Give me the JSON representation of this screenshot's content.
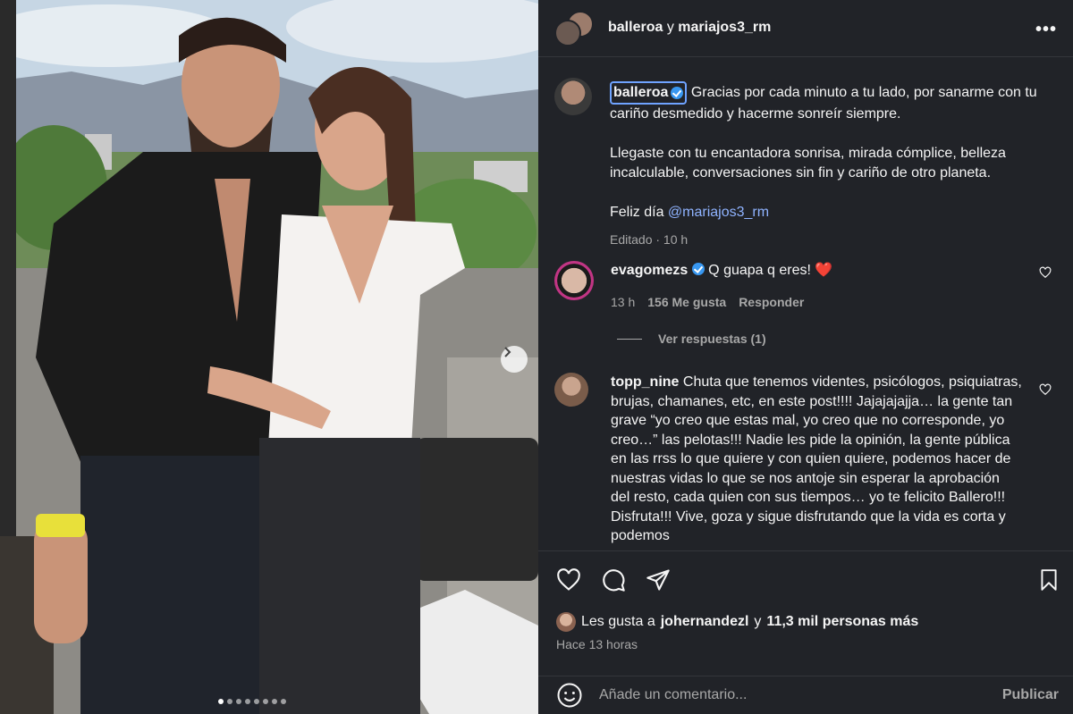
{
  "photo": {
    "carousel_dots": 8,
    "active_dot": 0,
    "next_icon": "chevron-right-icon"
  },
  "header": {
    "user1": "balleroa",
    "joiner": "y",
    "user2": "mariajos3_rm",
    "more_icon": "more-horizontal-icon",
    "more_label": "•••"
  },
  "caption": {
    "username": "balleroa",
    "line1": "Gracias por cada minuto a tu lado, por sanarme con tu cariño desmedido y hacerme sonreír siempre.",
    "para2": "Llegaste con tu encantadora sonrisa, mirada cómplice, belleza incalculable, conversaciones sin fin y cariño de otro planeta.",
    "para3_prefix": "Feliz día ",
    "para3_mention": "@mariajos3_rm",
    "meta": "Editado · 10 h"
  },
  "comments": [
    {
      "username": "evagomezs",
      "verified": true,
      "text": "Q guapa q eres! ❤️",
      "time": "13 h",
      "likes": "156 Me gusta",
      "reply": "Responder",
      "view_replies": "Ver respuestas (1)"
    },
    {
      "username": "topp_nine",
      "verified": false,
      "text": "Chuta que tenemos videntes, psicólogos, psiquiatras, brujas, chamanes, etc, en este post!!!! Jajajajajja… la gente tan grave “yo creo que estas mal, yo creo que no corresponde, yo creo…” las pelotas!!! Nadie les pide la opinión, la gente pública en las rrss lo que quiere y con quien quiere, podemos hacer de nuestras vidas lo que se nos antoje sin esperar la aprobación del resto, cada quien con sus tiempos… yo te felicito Ballero!!! Disfruta!!! Vive, goza y sigue disfrutando que la vida es corta y podemos"
    }
  ],
  "actions": {
    "like_icon": "heart-icon",
    "comment_icon": "comment-icon",
    "share_icon": "send-icon",
    "save_icon": "bookmark-icon",
    "likes_prefix": "Les gusta a ",
    "likes_user": "johernandezl",
    "likes_mid": " y ",
    "likes_count": "11,3 mil personas más",
    "posted": "Hace 13 horas"
  },
  "compose": {
    "emoji_icon": "emoji-icon",
    "placeholder": "Añade un comentario...",
    "publish": "Publicar"
  },
  "colors": {
    "panel_bg": "#212328",
    "verified_blue": "#3897f0",
    "mention": "#8fb3ff",
    "muted": "#a8a8a8",
    "heart_red": "#e0245e"
  }
}
